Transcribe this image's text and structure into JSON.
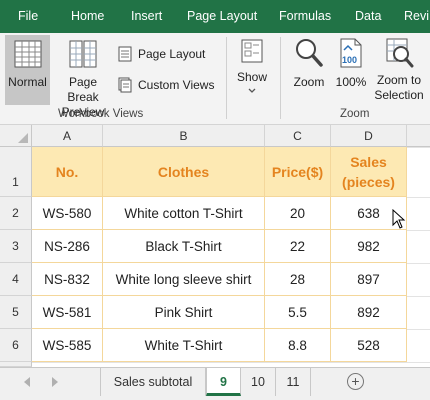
{
  "menu": {
    "tabs": [
      "File",
      "Home",
      "Insert",
      "Page Layout",
      "Formulas",
      "Data",
      "Revi"
    ]
  },
  "ribbon": {
    "normal_label": "Normal",
    "page_break_label_1": "Page Break",
    "page_break_label_2": "Preview",
    "page_layout_label": "Page Layout",
    "custom_views_label": "Custom Views",
    "workbook_views_group": "Workbook Views",
    "show_label": "Show",
    "zoom_label": "Zoom",
    "zoom100_label": "100%",
    "zoom_selection_label_1": "Zoom to",
    "zoom_selection_label_2": "Selection",
    "zoom_group": "Zoom",
    "zoom100_icon_text": "100"
  },
  "grid": {
    "columns": [
      "A",
      "B",
      "C",
      "D"
    ],
    "row_numbers": [
      "1",
      "2",
      "3",
      "4",
      "5",
      "6"
    ],
    "headers": [
      "No.",
      "Clothes",
      "Price($)",
      "Sales\n(pieces)"
    ],
    "rows": [
      [
        "WS-580",
        "White cotton T-Shirt",
        "20",
        "638"
      ],
      [
        "NS-286",
        "Black T-Shirt",
        "22",
        "982"
      ],
      [
        "NS-832",
        "White long sleeve shirt",
        "28",
        "897"
      ],
      [
        "WS-581",
        "Pink Shirt",
        "5.5",
        "892"
      ],
      [
        "WS-585",
        "White T-Shirt",
        "8.8",
        "528"
      ]
    ],
    "header_fill": "#fde9b3",
    "header_text_color": "#e4841f",
    "border_color": "#f4d79b"
  },
  "sheets": {
    "tabs": [
      "Sales subtotal",
      "9",
      "10",
      "11"
    ],
    "active_index": 1,
    "add_label": "+"
  },
  "colors": {
    "accent": "#217346"
  }
}
